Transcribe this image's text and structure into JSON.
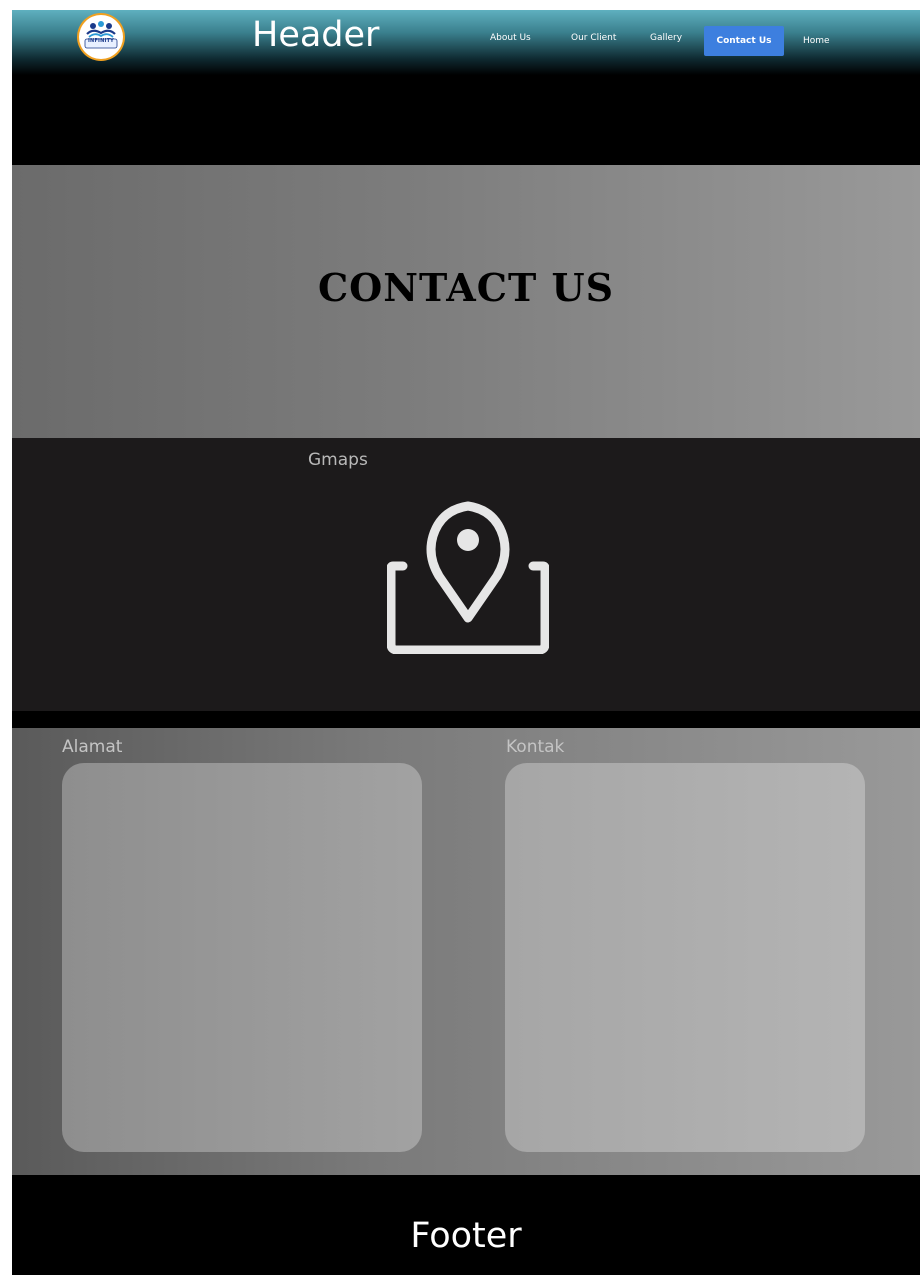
{
  "header": {
    "logo_text": "INFINITY",
    "title": "Header",
    "nav": [
      {
        "label": "About Us"
      },
      {
        "label": "Our Client"
      },
      {
        "label": "Gallery"
      },
      {
        "label": "Contact Us",
        "active": true
      },
      {
        "label": "Home"
      }
    ]
  },
  "hero": {
    "title": "CONTACT US"
  },
  "map": {
    "label": "Gmaps",
    "icon": "map-location-pin-icon"
  },
  "info": {
    "alamat_label": "Alamat",
    "kontak_label": "Kontak"
  },
  "footer": {
    "text": "Footer"
  },
  "colors": {
    "accent": "#3d7fdf",
    "header_top": "#5fb0bf",
    "map_bg": "#1c1a1b"
  }
}
